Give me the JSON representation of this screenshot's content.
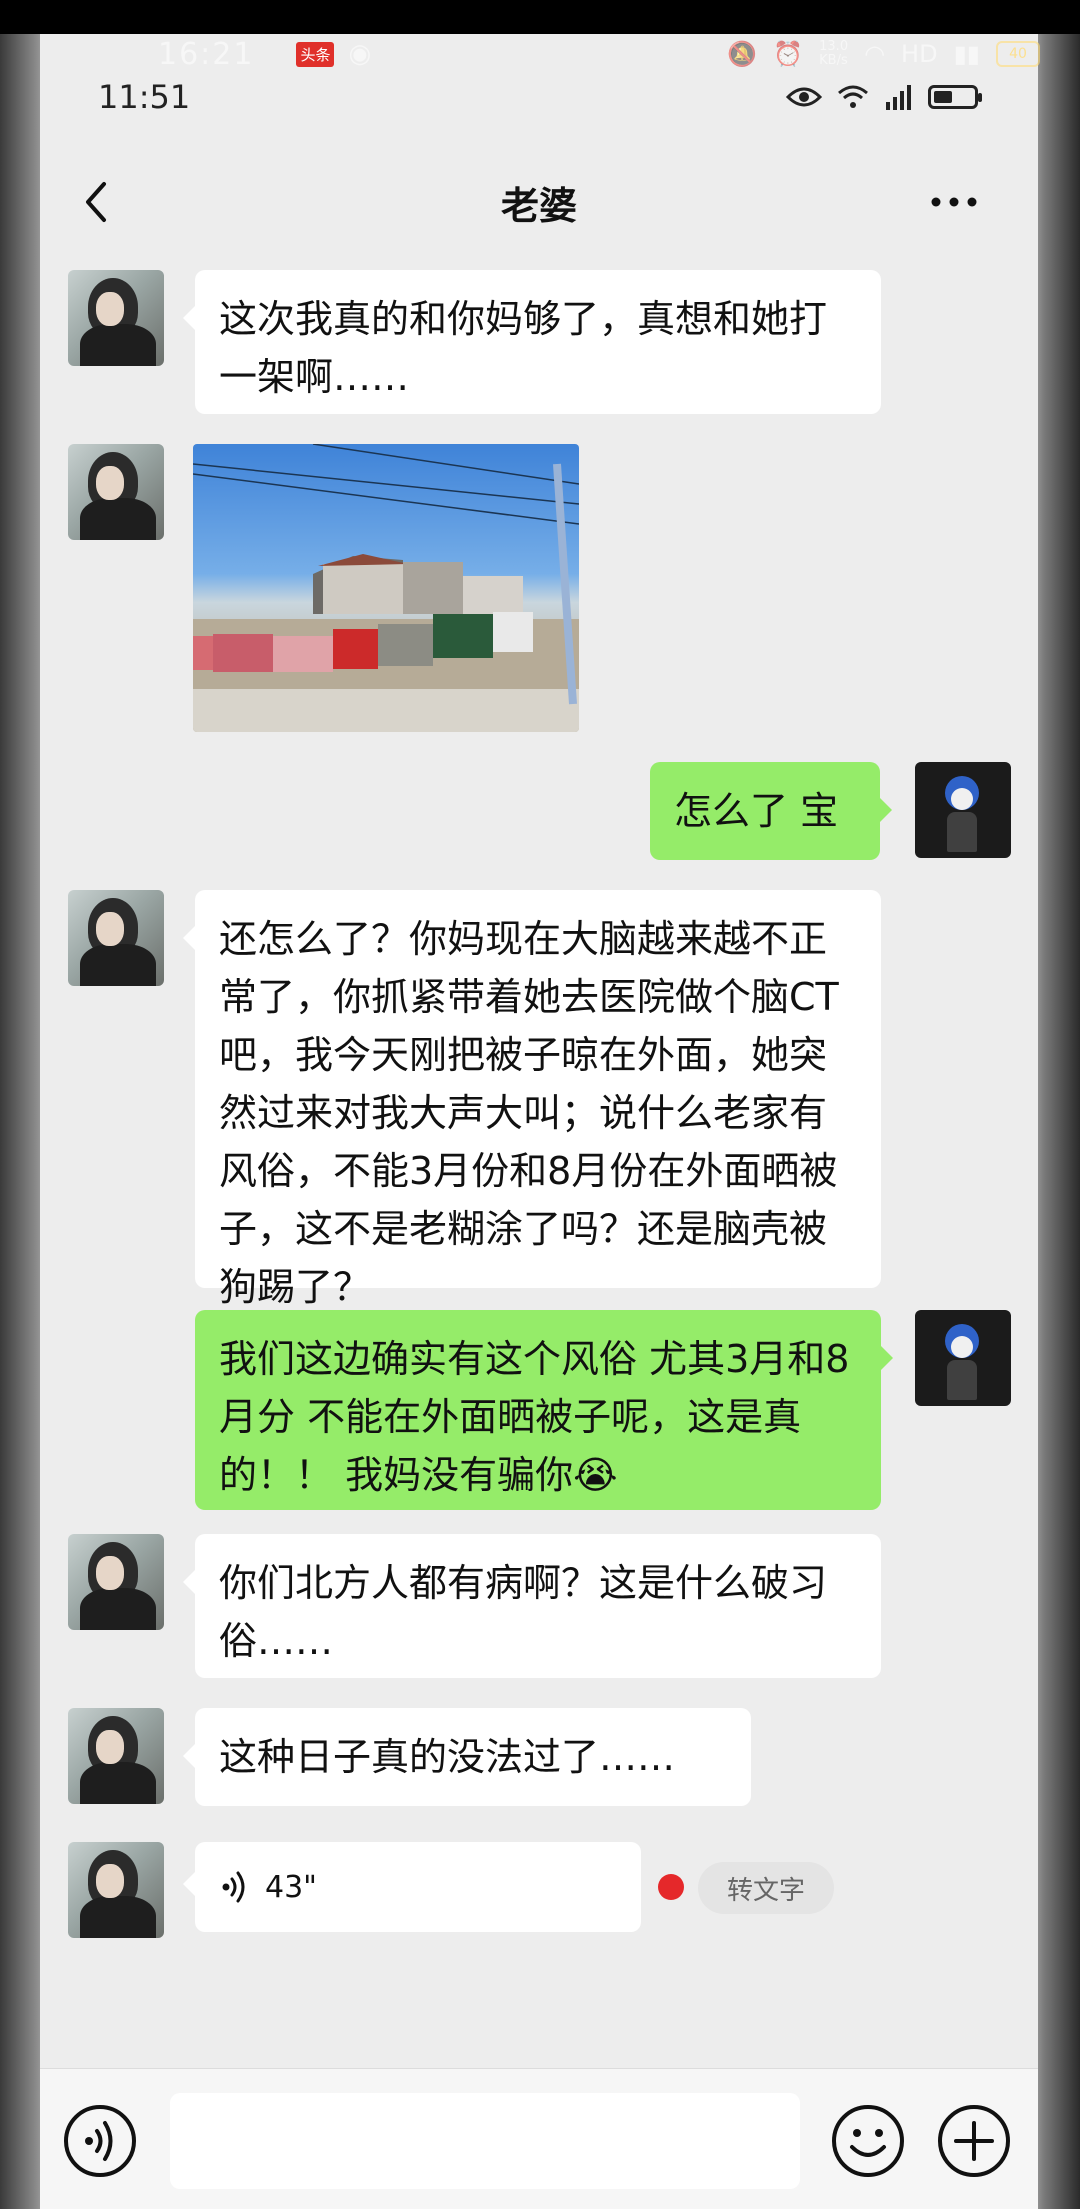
{
  "outer_status": {
    "time": "16:21",
    "app_badge": "头条",
    "network_speed": "13.0\nKB/s",
    "hd_label": "HD",
    "battery": "40"
  },
  "status_bar": {
    "time": "11:51"
  },
  "nav": {
    "title": "老婆"
  },
  "messages": [
    {
      "side": "left",
      "type": "text",
      "text": "这次我真的和你妈够了，真想和她打一架啊……"
    },
    {
      "side": "left",
      "type": "image"
    },
    {
      "side": "right",
      "type": "text",
      "text": "怎么了 宝"
    },
    {
      "side": "left",
      "type": "text",
      "text": "还怎么了？你妈现在大脑越来越不正常了，你抓紧带着她去医院做个脑CT吧，我今天刚把被子晾在外面，她突然过来对我大声大叫；说什么老家有风俗，不能3月份和8月份在外面晒被子，这不是老糊涂了吗？还是脑壳被狗踢了？"
    },
    {
      "side": "right",
      "type": "text",
      "text": "我们这边确实有这个风俗 尤其3月和8月分 不能在外面晒被子呢，这是真的！！ 我妈没有骗你😭"
    },
    {
      "side": "left",
      "type": "text",
      "text": "你们北方人都有病啊？这是什么破习俗……"
    },
    {
      "side": "left",
      "type": "text",
      "text": "这种日子真的没法过了……"
    },
    {
      "side": "left",
      "type": "voice",
      "duration": "43\"",
      "to_text_label": "转文字"
    }
  ],
  "input_bar": {
    "placeholder": ""
  },
  "colors": {
    "chat_bg": "#ededed",
    "bubble_mine": "#95ec69",
    "bubble_theirs": "#ffffff",
    "unread_dot": "#e5282a"
  }
}
